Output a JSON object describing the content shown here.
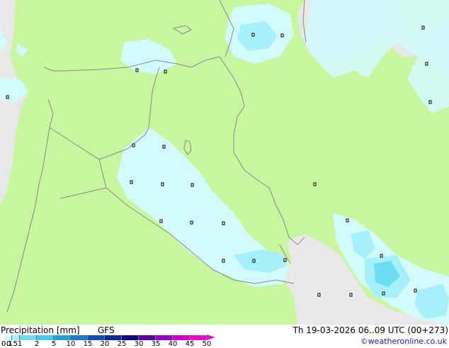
{
  "map": {
    "colors": {
      "land_with_data": "#c8f5a0",
      "outside_domain": "#e8e8e8",
      "water": "#e8e8e8",
      "precip_0_1": "#d2fafa",
      "precip_0_5": "#a6f0fa",
      "precip_1": "#6edcf0",
      "precip_2": "#46c8e6",
      "border_line": "#8a8a8a",
      "city_marker": "#000000"
    },
    "city_markers_count": 26
  },
  "legend": {
    "title": "Precipitation [mm]",
    "model": "GFS",
    "valid_time": "Th 19-03-2026 06..09 UTC (00+273)",
    "credit": "©weatheronline.co.uk",
    "ticks": [
      "0.1",
      "0.5",
      "1",
      "2",
      "5",
      "10",
      "15",
      "20",
      "25",
      "30",
      "35",
      "40",
      "45",
      "50"
    ],
    "colors": [
      "#d2fafa",
      "#a6f0fa",
      "#6edcf0",
      "#46c8e6",
      "#2aa0d2",
      "#1e78c8",
      "#1450b4",
      "#0a2896",
      "#0a0a78",
      "#5a00a0",
      "#9600be",
      "#c800c8",
      "#e010c8",
      "#f046d2"
    ]
  }
}
